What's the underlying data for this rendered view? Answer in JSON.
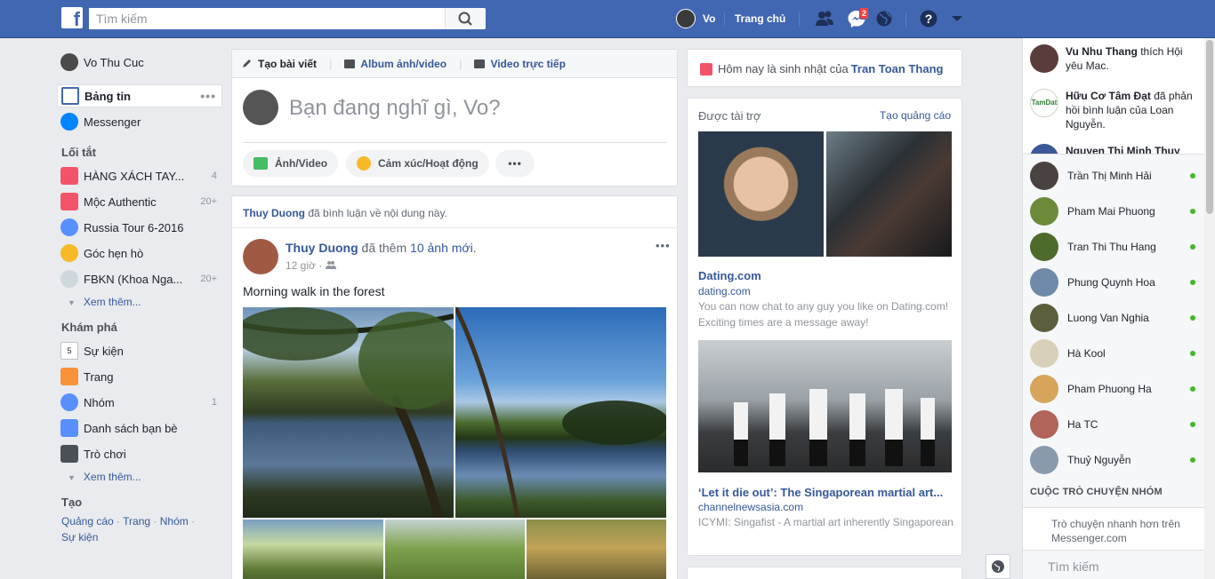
{
  "topbar": {
    "search_placeholder": "Tìm kiếm",
    "user_name": "Vo",
    "home_label": "Trang chủ",
    "messenger_badge": "2",
    "brand_color": "#4267b2"
  },
  "left_nav": {
    "profile_name": "Vo Thu Cuc",
    "news_feed": "Bảng tin",
    "messenger": "Messenger",
    "shortcuts_heading": "Lối tắt",
    "shortcuts": [
      {
        "label": "HÀNG XÁCH TAY...",
        "count": "4",
        "icon": "gift-icon"
      },
      {
        "label": "Mộc Authentic",
        "count": "20+",
        "icon": "gift-icon"
      },
      {
        "label": "Russia Tour 6-2016",
        "count": "",
        "icon": "group-icon"
      },
      {
        "label": "Góc hẹn hò",
        "count": "",
        "icon": "flower-icon"
      },
      {
        "label": "FBKN (Khoa Nga...",
        "count": "20+",
        "icon": "bird-icon"
      }
    ],
    "see_more_1": "Xem thêm...",
    "explore_heading": "Khám phá",
    "explore": [
      {
        "label": "Sự kiện",
        "count": "",
        "icon": "calendar-icon",
        "badge": "5"
      },
      {
        "label": "Trang",
        "count": "",
        "icon": "flag-icon"
      },
      {
        "label": "Nhóm",
        "count": "1",
        "icon": "group-icon"
      },
      {
        "label": "Danh sách bạn bè",
        "count": "",
        "icon": "friends-list-icon"
      },
      {
        "label": "Trò chơi",
        "count": "",
        "icon": "dice-icon"
      }
    ],
    "see_more_2": "Xem thêm...",
    "create_heading": "Tạo",
    "create_ad": "Quảng cáo",
    "create_page": "Trang",
    "create_group": "Nhóm",
    "create_event": "Sự kiện"
  },
  "composer": {
    "tab_post": "Tạo bài viết",
    "tab_album": "Album ảnh/video",
    "tab_live": "Video trực tiếp",
    "placeholder": "Bạn đang nghĩ gì, Vo?",
    "btn_photo": "Ảnh/Video",
    "btn_feeling": "Cảm xúc/Hoạt động",
    "btn_more": "•••"
  },
  "post": {
    "context_name": "Thuy Duong",
    "context_text": " đã bình luận về nội dung này.",
    "author": "Thuy Duong",
    "action_text": " đã thêm ",
    "action_link": "10 ảnh mới",
    "action_end": ".",
    "time": "12 giờ ·",
    "text": "Morning walk in the forest",
    "more": "•••"
  },
  "right": {
    "birthday_text": "Hôm nay là sinh nhật của ",
    "birthday_name": "Tran Toan Thang",
    "sponsored": "Được tài trợ",
    "create_ad": "Tạo quảng cáo",
    "ad1_title": "Dating.com",
    "ad1_domain": "dating.com",
    "ad1_desc": "You can now chat to any guy you like on Dating.com! Exciting times are a message away!",
    "ad2_title": "‘Let it die out’: The Singaporean martial art...",
    "ad2_domain": "channelnewsasia.com",
    "ad2_desc": "ICYMI: Singafist - A martial art inherently Singaporean"
  },
  "ticker": [
    {
      "name": "Vu Nhu Thang",
      "text": " thích Hội yêu Mac."
    },
    {
      "name": "Hữu Cơ Tâm Đạt",
      "text": " đã phản hồi bình luận của Loan Nguyễn."
    },
    {
      "name": "Nguyen Thi Minh Thuy",
      "text": ""
    }
  ],
  "chat": {
    "friends": [
      "Trần Thị Minh Hải",
      "Pham Mai Phuong",
      "Tran Thi Thu Hang",
      "Phung Quynh Hoa",
      "Luong Van Nghia",
      "Hà Kool",
      "Pham Phuong Ha",
      "Ha TC",
      "Thuỷ Nguyễn"
    ],
    "group_heading": "CUỘC TRÒ CHUYỆN NHÓM",
    "info_text": "Trò chuyện nhanh hơn trên Messenger.com",
    "search_placeholder": "Tìm kiếm"
  }
}
